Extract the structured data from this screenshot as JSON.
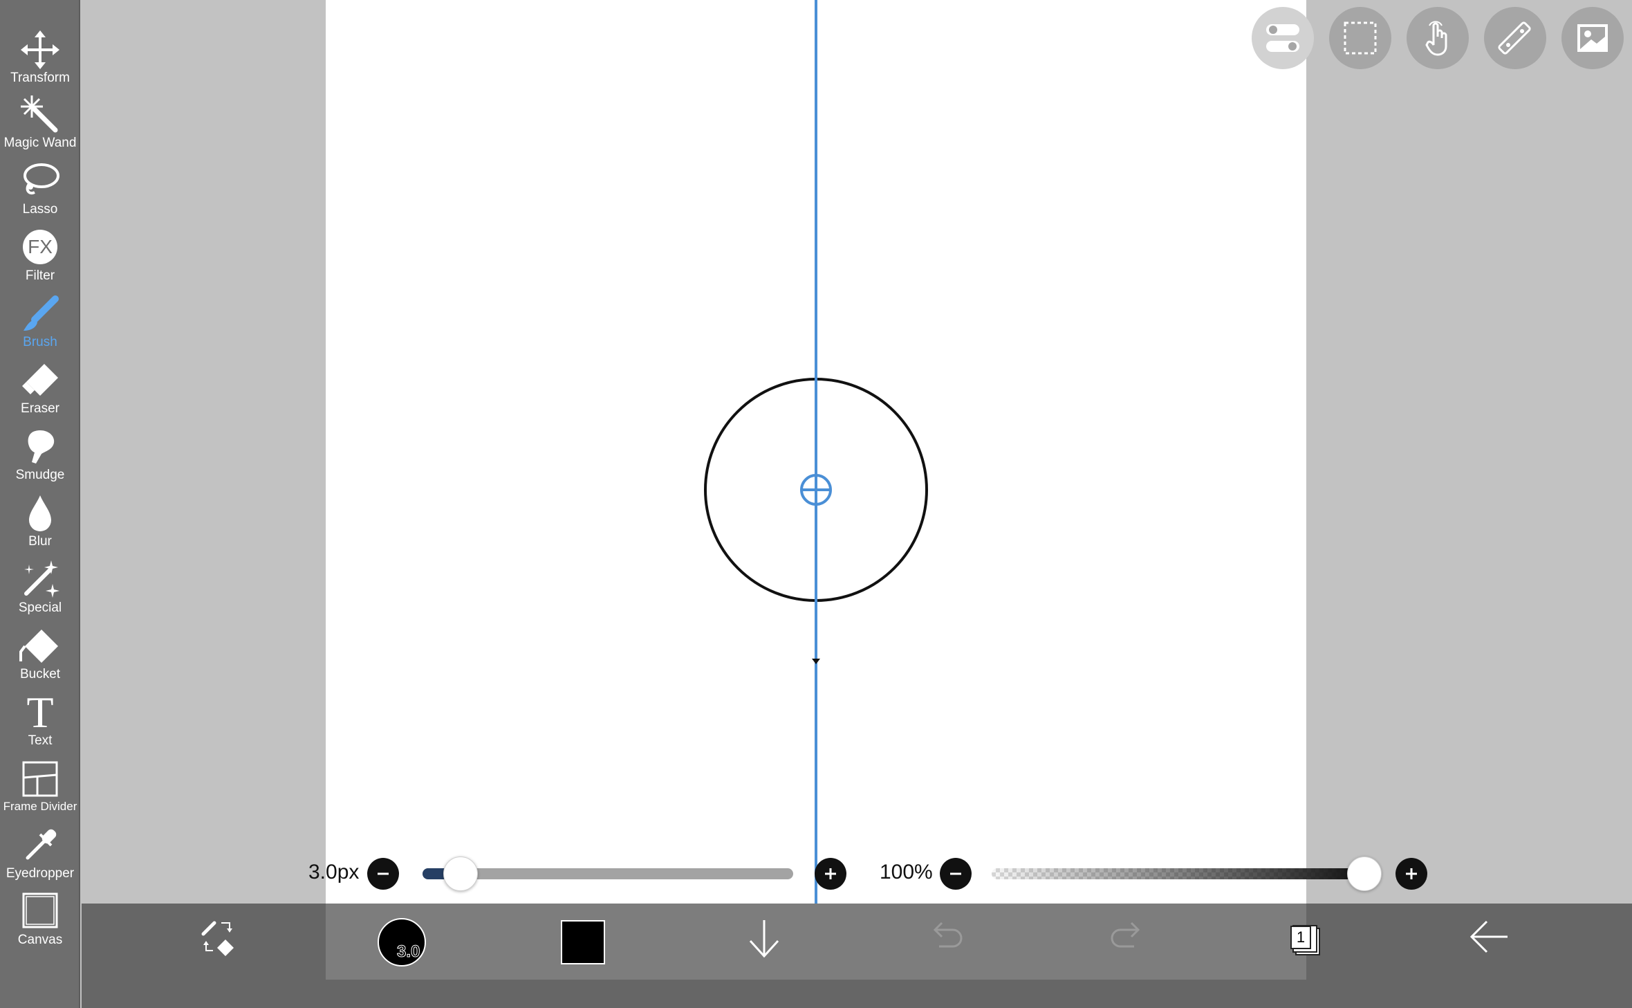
{
  "tools": [
    {
      "label": "Transform",
      "icon": "move-arrows-icon",
      "active": false
    },
    {
      "label": "Magic Wand",
      "icon": "magic-wand-icon",
      "active": false
    },
    {
      "label": "Lasso",
      "icon": "lasso-icon",
      "active": false
    },
    {
      "label": "Filter",
      "icon": "fx-filter-icon",
      "active": false,
      "glyph": "FX"
    },
    {
      "label": "Brush",
      "icon": "brush-icon",
      "active": true
    },
    {
      "label": "Eraser",
      "icon": "eraser-icon",
      "active": false
    },
    {
      "label": "Smudge",
      "icon": "smudge-icon",
      "active": false
    },
    {
      "label": "Blur",
      "icon": "droplet-icon",
      "active": false
    },
    {
      "label": "Special",
      "icon": "sparkle-pen-icon",
      "active": false
    },
    {
      "label": "Bucket",
      "icon": "bucket-icon",
      "active": false
    },
    {
      "label": "Text",
      "icon": "text-t-icon",
      "active": false,
      "glyph": "T"
    },
    {
      "label": "Frame Divider",
      "icon": "frame-divider-icon",
      "active": false
    },
    {
      "label": "Eyedropper",
      "icon": "eyedropper-icon",
      "active": false
    },
    {
      "label": "Canvas",
      "icon": "canvas-square-icon",
      "active": false
    }
  ],
  "top_buttons": [
    "toggle-icon",
    "selection-icon",
    "touch-hand-icon",
    "ruler-icon",
    "image-icon"
  ],
  "brush_size": {
    "label": "3.0px",
    "value_fraction": 0.1
  },
  "opacity": {
    "label": "100%",
    "value_fraction": 1.0
  },
  "bottom_bar": {
    "brush_preview_size": "3.0",
    "color": "#000000",
    "layer_count": "1"
  },
  "colors": {
    "accent": "#5aa6f0",
    "guide": "#4a8fd6",
    "toolbar": "#6e6e6e",
    "bottom": "#666666"
  }
}
